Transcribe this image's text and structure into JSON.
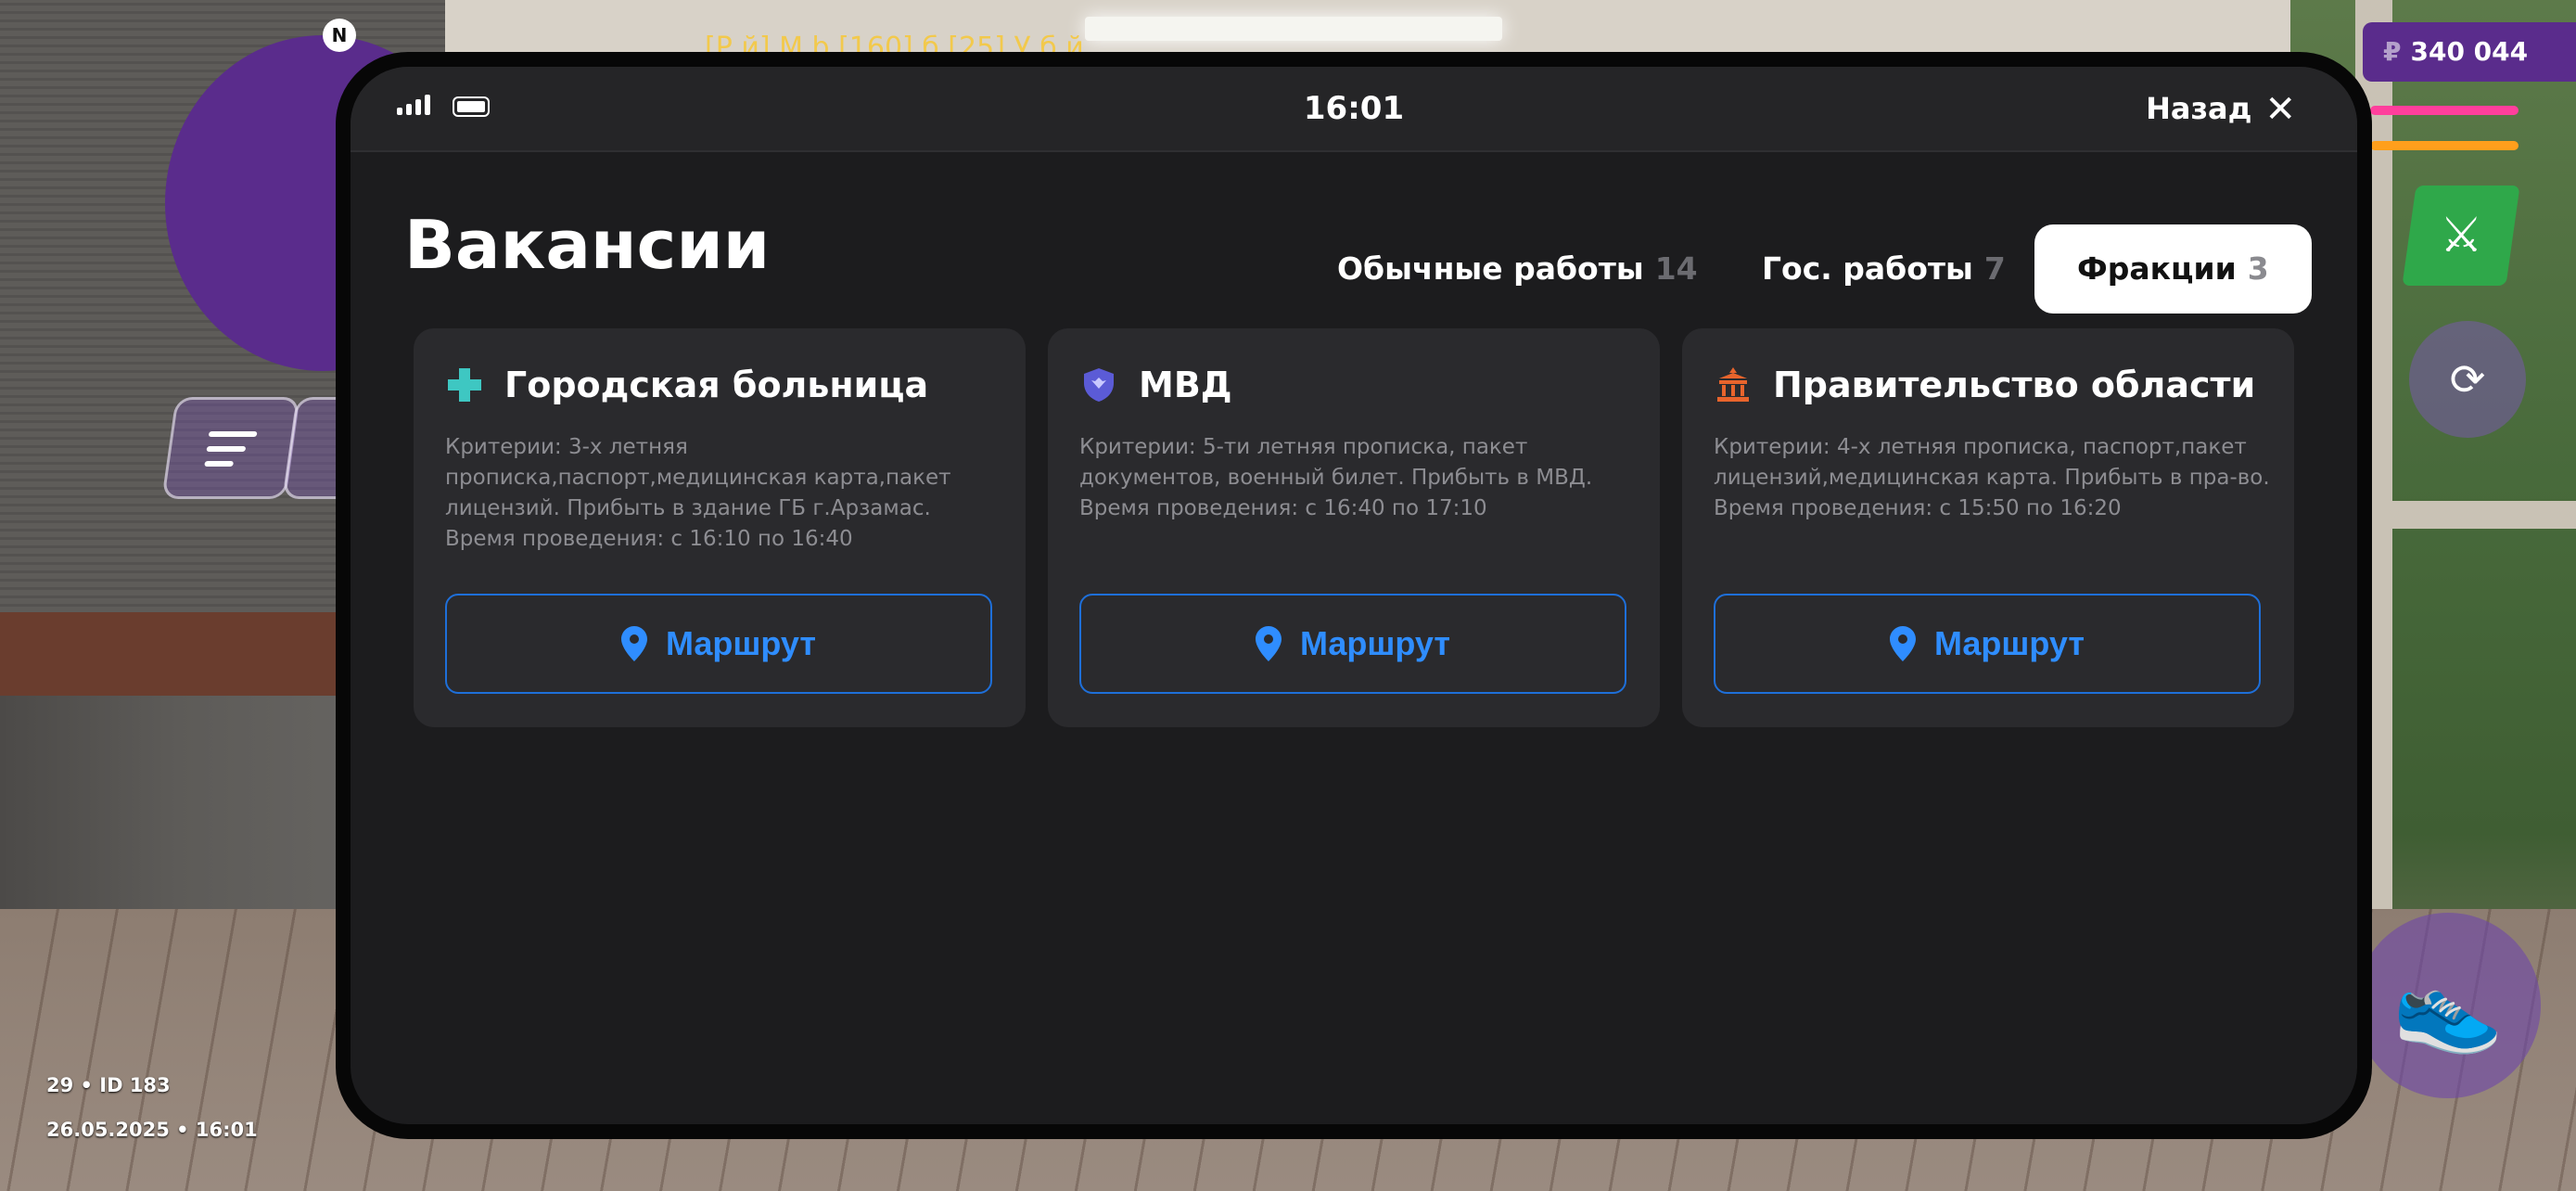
{
  "hud": {
    "compass_label": "N",
    "money_symbol": "₽",
    "money_value": "340 044",
    "chat_text": "[Р   й] М              b [160] б       [25]    У б й",
    "player_info": "29 • ID 183",
    "datetime": "26.05.2025 • 16:01",
    "health_bar_color": "#ff3f9c",
    "hunger_bar_color": "#ff9f1c",
    "health_level": 0.88,
    "hunger_level": 0.88,
    "weapon_icon": "rifle-icon",
    "camera_icon": "camera-rotate-icon",
    "sprint_icon": "sneaker-icon"
  },
  "phone": {
    "time": "16:01",
    "back_label": "Назад",
    "title": "Вакансии",
    "tabs": [
      {
        "label": "Обычные работы",
        "count": "14",
        "active": false
      },
      {
        "label": "Гос. работы",
        "count": "7",
        "active": false
      },
      {
        "label": "Фракции",
        "count": "3",
        "active": true
      }
    ],
    "accent_color": "#2f8dff",
    "cards": [
      {
        "title": "Городская больница",
        "icon": "medical-cross-icon",
        "icon_color": "#3ec7c2",
        "description": "Критерии: 3-х летняя прописка,паспорт,медицинская карта,пакет лицензий. Прибыть в здание ГБ г.Арзамас. Время проведения: с 16:10 по 16:40",
        "button_label": "Маршрут"
      },
      {
        "title": "МВД",
        "icon": "police-shield-icon",
        "icon_color": "#5b5bd6",
        "description": "Критерии: 5-ти летняя прописка, пакет документов, военный билет. Прибыть в МВД. Время проведения: с 16:40 по 17:10",
        "button_label": "Маршрут"
      },
      {
        "title": "Правительство области",
        "icon": "government-building-icon",
        "icon_color": "#e8642c",
        "description": "Критерии: 4-х летняя прописка, паспорт,пакет лицензий,медицинская карта. Прибыть в пра-во. Время проведения: с 15:50 по 16:20",
        "button_label": "Маршрут"
      }
    ]
  }
}
